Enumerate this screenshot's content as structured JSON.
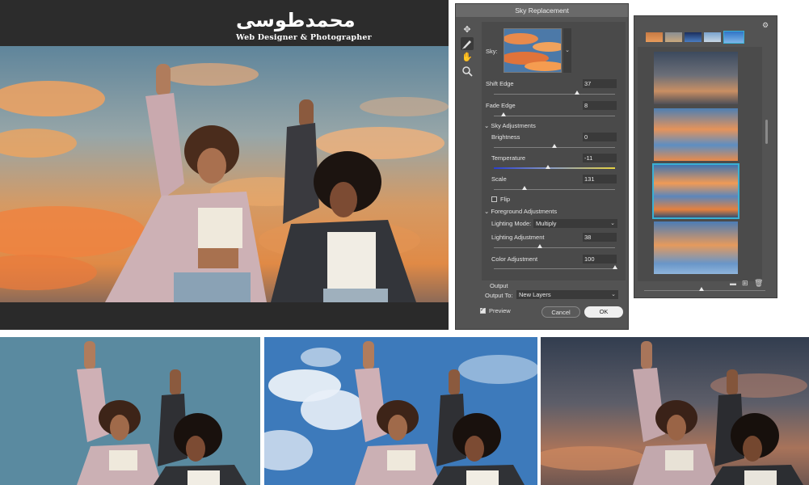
{
  "logo": {
    "script_text": "محمدطوسی",
    "subtitle": "Web Designer & Photographer"
  },
  "dialog": {
    "title": "Sky Replacement",
    "tools": [
      "move-sky-icon",
      "sky-brush-icon",
      "hand-icon",
      "zoom-icon"
    ],
    "sky_label": "Sky:",
    "shift_edge": {
      "label": "Shift Edge",
      "value": "37",
      "level": 0.685
    },
    "fade_edge": {
      "label": "Fade Edge",
      "value": "8",
      "level": 0.08
    },
    "sky_adjustments": {
      "header": "Sky Adjustments",
      "brightness": {
        "label": "Brightness",
        "value": "0",
        "level": 0.5
      },
      "temperature": {
        "label": "Temperature",
        "value": "-11",
        "level": 0.445
      },
      "scale": {
        "label": "Scale",
        "value": "131",
        "level": 0.25
      },
      "flip": {
        "label": "Flip",
        "checked": false
      }
    },
    "foreground_adjustments": {
      "header": "Foreground Adjustments",
      "lighting_mode": {
        "label": "Lighting Mode:",
        "value": "Multiply"
      },
      "lighting_adjustment": {
        "label": "Lighting Adjustment",
        "value": "38",
        "level": 0.38
      },
      "color_adjustment": {
        "label": "Color Adjustment",
        "value": "100",
        "level": 1.0
      }
    },
    "output": {
      "header": "Output",
      "output_to": {
        "label": "Output To:",
        "value": "New Layers"
      }
    },
    "preview": {
      "label": "Preview",
      "checked": true
    },
    "cancel_label": "Cancel",
    "ok_label": "OK"
  },
  "presets": {
    "gear_icon": "gear-icon",
    "footer_icons": [
      "folder-icon",
      "new-preset-icon",
      "trash-icon"
    ],
    "selected_index": 2
  },
  "colors": {
    "accent": "#39b0d4",
    "dialog_bg": "#535353",
    "panel_bg": "#4a4a4a"
  }
}
